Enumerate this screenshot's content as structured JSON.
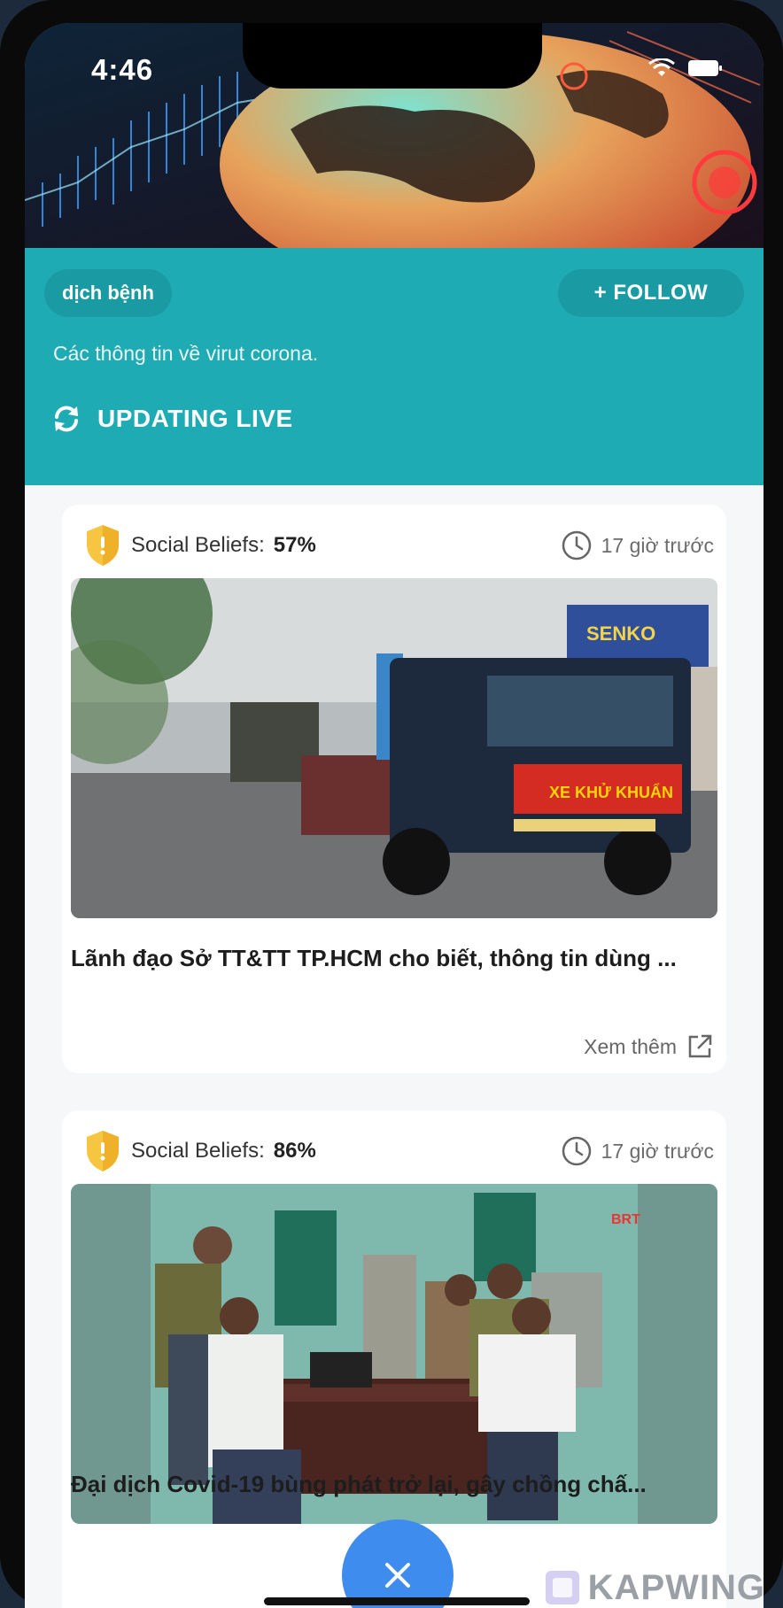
{
  "status_bar": {
    "time": "4:46",
    "wifi_icon": "wifi-icon",
    "battery_icon": "battery-icon"
  },
  "topic": {
    "tag": "dịch bệnh",
    "follow_label": "+ FOLLOW",
    "description": "Các thông tin về virut corona.",
    "live_label": "UPDATING LIVE",
    "live_icon": "refresh-icon",
    "color": "#1fabb4"
  },
  "feed": [
    {
      "belief_label": "Social Beliefs:",
      "belief_value": "57%",
      "time": "17 giờ trước",
      "image_overlay_text": "XE KHỬ KHUẨN",
      "sign_text": "SENKO",
      "headline": "Lãnh đạo Sở TT&TT TP.HCM cho biết, thông tin dùng ...",
      "more_label": "Xem thêm"
    },
    {
      "belief_label": "Social Beliefs:",
      "belief_value": "86%",
      "time": "17 giờ trước",
      "channel_logo": "BRT",
      "headline": "Đại dịch Covid-19 bùng phát trở lại, gây chồng chấ..."
    }
  ],
  "fab": {
    "icon": "close-icon",
    "color": "#3f8cef"
  },
  "watermark": "KAPWING"
}
